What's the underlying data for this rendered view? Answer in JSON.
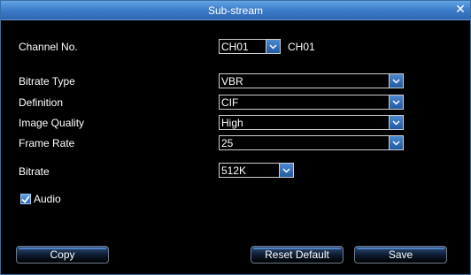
{
  "window": {
    "title": "Sub-stream",
    "close_glyph": "✕"
  },
  "channel": {
    "label": "Channel No.",
    "value": "CH01",
    "name": "CH01"
  },
  "bitrate_type": {
    "label": "Bitrate Type",
    "value": "VBR"
  },
  "definition": {
    "label": "Definition",
    "value": "CIF"
  },
  "image_quality": {
    "label": "Image Quality",
    "value": "High"
  },
  "frame_rate": {
    "label": "Frame Rate",
    "value": "25"
  },
  "bitrate": {
    "label": "Bitrate",
    "value": "512K"
  },
  "audio": {
    "label": "Audio",
    "checked": true
  },
  "buttons": {
    "copy": "Copy",
    "reset": "Reset Default",
    "save": "Save"
  },
  "colors": {
    "title_bar": "#3f7fcb",
    "background": "#000000",
    "accent": "#2d66b1"
  }
}
